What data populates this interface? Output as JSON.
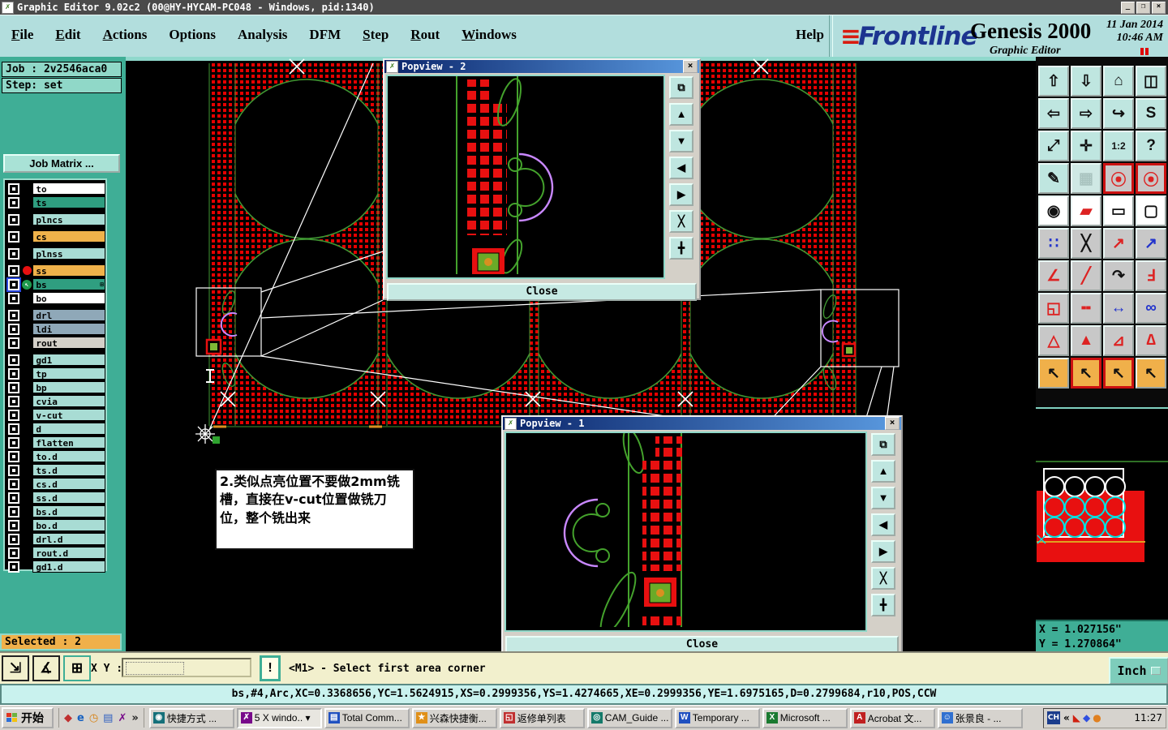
{
  "window": {
    "title": "Graphic Editor 9.02c2 (00@HY-HYCAM-PC048 - Windows, pid:1340)",
    "minimize": "_",
    "restore": "❐",
    "close": "×"
  },
  "menu": {
    "items": [
      {
        "label": "File",
        "u": 0
      },
      {
        "label": "Edit",
        "u": 0
      },
      {
        "label": "Actions",
        "u": 0
      },
      {
        "label": "Options",
        "u": -1
      },
      {
        "label": "Analysis",
        "u": -1
      },
      {
        "label": "DFM",
        "u": -1
      },
      {
        "label": "Step",
        "u": 0
      },
      {
        "label": "Rout",
        "u": 0
      },
      {
        "label": "Windows",
        "u": 0
      }
    ],
    "help": "Help"
  },
  "brand": {
    "logo_lines": "≡",
    "logo": "Frontline",
    "product": "Genesis 2000",
    "subtitle": "Graphic Editor",
    "datetime": "11 Jan 2014\n10:46 AM"
  },
  "job": {
    "job_label": "Job : 2v2546aca0",
    "step_label": "Step: set",
    "matrix_button": "Job Matrix ..."
  },
  "layers": [
    {
      "name": "to",
      "bg": "#ffffff"
    },
    {
      "name": "ts",
      "bg": "#2f9e80"
    },
    {
      "name": "plncs",
      "bg": "#a8dcd4",
      "gap": true
    },
    {
      "name": "cs",
      "bg": "#f0b24a",
      "gap": true
    },
    {
      "name": "plnss",
      "bg": "#a8dcd4",
      "gap": true
    },
    {
      "name": "ss",
      "bg": "#f0b24a",
      "gap": true,
      "icon": "red-dot"
    },
    {
      "name": "bs",
      "bg": "#2f9e80",
      "icon": "green-arrow",
      "active": true,
      "plus": "⊞"
    },
    {
      "name": "bo",
      "bg": "#ffffff"
    },
    {
      "name": "drl",
      "bg": "#8fa8b8",
      "gap": true
    },
    {
      "name": "ldi",
      "bg": "#8fa8b8"
    },
    {
      "name": "rout",
      "bg": "#d4d0c8"
    },
    {
      "name": "gd1",
      "bg": "#a8dcd4",
      "gap": true
    },
    {
      "name": "tp",
      "bg": "#a8dcd4"
    },
    {
      "name": "bp",
      "bg": "#a8dcd4"
    },
    {
      "name": "cvia",
      "bg": "#a8dcd4"
    },
    {
      "name": "v-cut",
      "bg": "#a8dcd4"
    },
    {
      "name": "d",
      "bg": "#a8dcd4"
    },
    {
      "name": "flatten",
      "bg": "#a8dcd4"
    },
    {
      "name": "to.d",
      "bg": "#a8dcd4"
    },
    {
      "name": "ts.d",
      "bg": "#a8dcd4"
    },
    {
      "name": "cs.d",
      "bg": "#a8dcd4"
    },
    {
      "name": "ss.d",
      "bg": "#a8dcd4"
    },
    {
      "name": "bs.d",
      "bg": "#a8dcd4"
    },
    {
      "name": "bo.d",
      "bg": "#a8dcd4"
    },
    {
      "name": "drl.d",
      "bg": "#a8dcd4"
    },
    {
      "name": "rout.d",
      "bg": "#a8dcd4"
    },
    {
      "name": "gd1.d",
      "bg": "#a8dcd4"
    }
  ],
  "selected_label": "Selected : 2",
  "annotation": "2.类似点亮位置不要做2mm铣槽，直接在v-cut位置做铣刀位，整个铣出来",
  "popviews": {
    "pv2": {
      "title": "Popview - 2",
      "close_x": "×",
      "close": "Close"
    },
    "pv1": {
      "title": "Popview - 1",
      "close_x": "×",
      "close": "Close"
    }
  },
  "popview_side_buttons": [
    "⧉",
    "▲",
    "▼",
    "◀",
    "▶",
    "╳",
    "╋"
  ],
  "toolbar": {
    "buttons": [
      {
        "g": "⇧",
        "bg": "#bfe6e0",
        "fg": "#111"
      },
      {
        "g": "⇩",
        "bg": "#bfe6e0",
        "fg": "#111"
      },
      {
        "g": "⌂",
        "bg": "#bfe6e0",
        "fg": "#111"
      },
      {
        "g": "◫",
        "bg": "#bfe6e0",
        "fg": "#111"
      },
      {
        "g": "⇦",
        "bg": "#bfe6e0",
        "fg": "#111"
      },
      {
        "g": "⇨",
        "bg": "#bfe6e0",
        "fg": "#111"
      },
      {
        "g": "↪",
        "bg": "#bfe6e0",
        "fg": "#111"
      },
      {
        "g": "S",
        "bg": "#bfe6e0",
        "fg": "#111"
      },
      {
        "g": "⤢",
        "bg": "#bfe6e0",
        "fg": "#111"
      },
      {
        "g": "✛",
        "bg": "#bfe6e0",
        "fg": "#111"
      },
      {
        "g": "1:2",
        "bg": "#bfe6e0",
        "fg": "#111",
        "small": true
      },
      {
        "g": "?",
        "bg": "#bfe6e0",
        "fg": "#111"
      },
      {
        "g": "✎",
        "bg": "#bfe6e0",
        "fg": "#111"
      },
      {
        "g": "▦",
        "bg": "#cfe8e4",
        "fg": "#aac4c0"
      },
      {
        "g": "⦿",
        "bg": "#c8c8c8",
        "fg": "#d22",
        "red": true
      },
      {
        "g": "⦿",
        "bg": "#c8c8c8",
        "fg": "#d22",
        "red": true
      },
      {
        "g": "◉",
        "bg": "#ffffff",
        "fg": "#111"
      },
      {
        "g": "▰",
        "bg": "#ffffff",
        "fg": "#d22"
      },
      {
        "g": "▭",
        "bg": "#ffffff",
        "fg": "#111"
      },
      {
        "g": "▢",
        "bg": "#ffffff",
        "fg": "#111"
      },
      {
        "g": "∷",
        "bg": "#c8c8c8",
        "fg": "#23c"
      },
      {
        "g": "╳",
        "bg": "#c8c8c8",
        "fg": "#111"
      },
      {
        "g": "↗",
        "bg": "#c8c8c8",
        "fg": "#d22"
      },
      {
        "g": "↗",
        "bg": "#c8c8c8",
        "fg": "#23c"
      },
      {
        "g": "∠",
        "bg": "#c8c8c8",
        "fg": "#d22"
      },
      {
        "g": "╱",
        "bg": "#c8c8c8",
        "fg": "#d22"
      },
      {
        "g": "↷",
        "bg": "#c8c8c8",
        "fg": "#111"
      },
      {
        "g": "Ⅎ",
        "bg": "#c8c8c8",
        "fg": "#d22"
      },
      {
        "g": "◱",
        "bg": "#c8c8c8",
        "fg": "#d22"
      },
      {
        "g": "╍",
        "bg": "#c8c8c8",
        "fg": "#d22"
      },
      {
        "g": "↔",
        "bg": "#c8c8c8",
        "fg": "#23c"
      },
      {
        "g": "∞",
        "bg": "#c8c8c8",
        "fg": "#23c"
      },
      {
        "g": "△",
        "bg": "#c8c8c8",
        "fg": "#d22"
      },
      {
        "g": "▲",
        "bg": "#c8c8c8",
        "fg": "#d22"
      },
      {
        "g": "⊿",
        "bg": "#c8c8c8",
        "fg": "#d22"
      },
      {
        "g": "∆",
        "bg": "#c8c8c8",
        "fg": "#d22"
      },
      {
        "g": "↖",
        "bg": "#f0b04a",
        "fg": "#111"
      },
      {
        "g": "↖",
        "bg": "#f0b04a",
        "fg": "#111",
        "red": true
      },
      {
        "g": "↖",
        "bg": "#f0b04a",
        "fg": "#111",
        "red": true
      },
      {
        "g": "↖",
        "bg": "#f0b04a",
        "fg": "#111"
      }
    ]
  },
  "coords": {
    "x": "X = 1.027156\"",
    "y": "Y = 1.270864\"",
    "unit": "Inch"
  },
  "statusbar": {
    "buttons": [
      "⇲",
      "∡",
      "⊞"
    ],
    "xy_label": "X Y :",
    "input_value": "",
    "bang": "!",
    "message": "<M1> - Select first area corner"
  },
  "command_line": "bs,#4,Arc,XC=0.3368656,YC=1.5624915,XS=0.2999356,YS=1.4274665,XE=0.2999356,YE=1.6975165,D=0.2799684,r10,POS,CCW",
  "taskbar": {
    "start": "开始",
    "quick": [
      {
        "g": "◆",
        "c": "#c03030"
      },
      {
        "g": "e",
        "c": "#1560c0"
      },
      {
        "g": "◷",
        "c": "#d88010"
      },
      {
        "g": "▤",
        "c": "#3060c0"
      },
      {
        "g": "✗",
        "c": "#780a8a"
      },
      {
        "g": "»",
        "c": "#222222"
      }
    ],
    "tasks": [
      {
        "label": "快捷方式 ...",
        "g": "◉",
        "c": "#15707a"
      },
      {
        "label": "5 X windo.. ▾",
        "g": "✗",
        "c": "#780a8a",
        "pressed": true
      },
      {
        "label": "Total Comm...",
        "g": "▤",
        "c": "#2050c0"
      },
      {
        "label": "兴森快捷衡...",
        "g": "★",
        "c": "#e09018"
      },
      {
        "label": "返修单列表",
        "g": "◱",
        "c": "#c03030"
      },
      {
        "label": "CAM_Guide ...",
        "g": "◎",
        "c": "#157a6a"
      },
      {
        "label": "Temporary ...",
        "g": "W",
        "c": "#2050c0"
      },
      {
        "label": "Microsoft ...",
        "g": "X",
        "c": "#1a7a30"
      },
      {
        "label": "Acrobat 文...",
        "g": "A",
        "c": "#c02020"
      },
      {
        "label": "张景良 - ...",
        "g": "☺",
        "c": "#3070d0"
      }
    ],
    "tray": {
      "ch": "CH",
      "chevron": "«",
      "icons": [
        {
          "g": "◣",
          "c": "#d02010"
        },
        {
          "g": "◆",
          "c": "#3050e0"
        },
        {
          "g": "●",
          "c": "#e08020"
        }
      ],
      "clock": "11:27"
    }
  }
}
